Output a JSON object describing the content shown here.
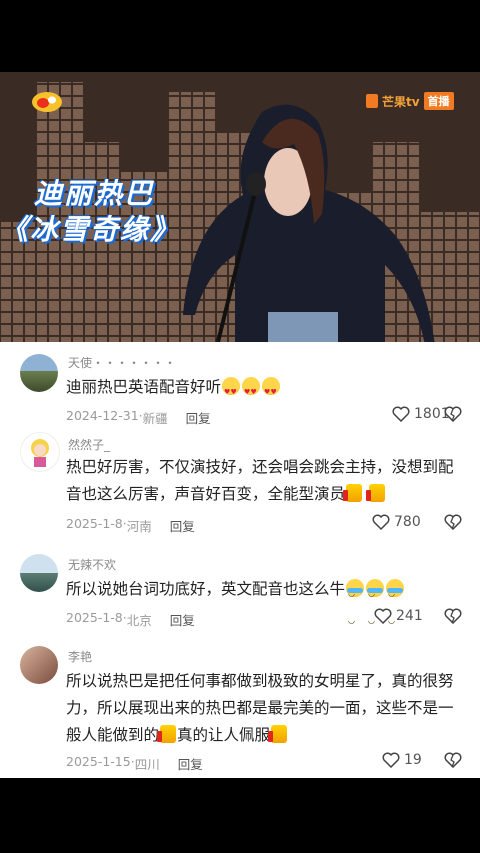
{
  "video": {
    "watermark_brand": "芒果tv",
    "watermark_badge": "首播",
    "title_line1": "迪丽热巴",
    "title_line2": "《冰雪奇缘》"
  },
  "comments": [
    {
      "username": "天使・・・・・・・",
      "text": "迪丽热巴英语配音好听",
      "emojis": [
        "heart-eyes-icon",
        "heart-eyes-icon",
        "heart-eyes-icon"
      ],
      "date": "2024-12-31",
      "location": "新疆",
      "reply": "回复",
      "likes": "1801"
    },
    {
      "username": "然然子_",
      "text": "热巴好厉害，不仅演技好，还会唱会跳会主持，没想到配音也这么厉害，声音好百变，全能型演员",
      "emojis": [
        "thumbs-up-icon",
        "thumbs-up-icon"
      ],
      "date": "2025-1-8",
      "location": "河南",
      "reply": "回复",
      "likes": "780"
    },
    {
      "username": "无辣不欢",
      "text": "所以说她台词功底好，英文配音也这么牛",
      "emojis": [
        "crying-laugh-icon",
        "crying-laugh-icon",
        "crying-laugh-icon"
      ],
      "date": "2025-1-8",
      "location": "北京",
      "reply": "回复",
      "likes": "241"
    },
    {
      "username": "李艳",
      "text_part1": "所以说热巴是把任何事都做到极致的女明星了，真的很努力，所以展现出来的热巴都是最完美的一面，这些不是一般人能做到的",
      "text_part2": "真的让人佩服",
      "emojis": [
        "thumbs-up-icon",
        "thumbs-up-icon"
      ],
      "date": "2025-1-15",
      "location": "四川",
      "reply": "回复",
      "likes": "19"
    }
  ],
  "colors": {
    "title_outline": "#1a6bd6",
    "brand_orange": "#f27a22"
  }
}
